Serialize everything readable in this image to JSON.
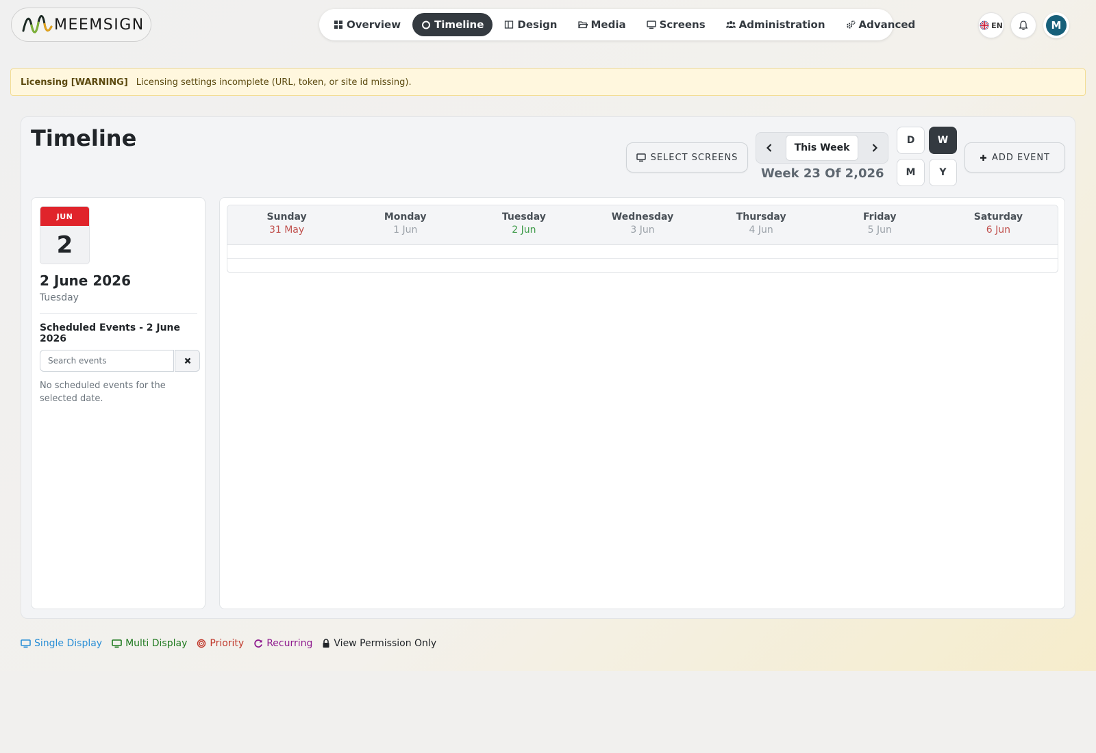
{
  "brand": {
    "name": "MEEMSIGN"
  },
  "nav": {
    "items": [
      {
        "label": "Overview",
        "icon": "grid-icon"
      },
      {
        "label": "Timeline",
        "icon": "circle-icon",
        "active": true
      },
      {
        "label": "Design",
        "icon": "columns-icon"
      },
      {
        "label": "Media",
        "icon": "folder-icon"
      },
      {
        "label": "Screens",
        "icon": "monitor-icon"
      },
      {
        "label": "Administration",
        "icon": "users-icon"
      },
      {
        "label": "Advanced",
        "icon": "gears-icon"
      }
    ]
  },
  "topbar": {
    "language": "EN",
    "avatar_initial": "M"
  },
  "warning": {
    "title": "Licensing [WARNING]",
    "message": "Licensing settings incomplete (URL, token, or site id missing)."
  },
  "page": {
    "title": "Timeline",
    "select_screens_label": "SELECT SCREENS",
    "this_week_label": "This Week",
    "week_label": "Week 23 Of 2,026",
    "add_event_label": "ADD EVENT",
    "views": {
      "day": "D",
      "week": "W",
      "month": "M",
      "year": "Y",
      "active": "W"
    }
  },
  "sidebar": {
    "cal_month": "JUN",
    "cal_day": "2",
    "selected_date": "2 June 2026",
    "selected_weekday": "Tuesday",
    "scheduled_title": "Scheduled Events - 2 June 2026",
    "search_placeholder": "Search events",
    "search_value": "",
    "empty_message": "No scheduled events for the selected date."
  },
  "week": {
    "days": [
      {
        "name": "Sunday",
        "date": "31 May",
        "color": "#c0504d"
      },
      {
        "name": "Monday",
        "date": "1 Jun",
        "color": "#9aa1a8"
      },
      {
        "name": "Tuesday",
        "date": "2 Jun",
        "color": "#3f9b4a"
      },
      {
        "name": "Wednesday",
        "date": "3 Jun",
        "color": "#9aa1a8"
      },
      {
        "name": "Thursday",
        "date": "4 Jun",
        "color": "#9aa1a8"
      },
      {
        "name": "Friday",
        "date": "5 Jun",
        "color": "#9aa1a8"
      },
      {
        "name": "Saturday",
        "date": "6 Jun",
        "color": "#c0504d"
      }
    ]
  },
  "legend": [
    {
      "label": "Single Display",
      "color": "#2b8fd6",
      "icon": "monitor-icon"
    },
    {
      "label": "Multi Display",
      "color": "#1f7a1f",
      "icon": "monitor-icon"
    },
    {
      "label": "Priority",
      "color": "#c0392b",
      "icon": "target-icon"
    },
    {
      "label": "Recurring",
      "color": "#8e1a8e",
      "icon": "refresh-icon"
    },
    {
      "label": "View Permission Only",
      "color": "#212529",
      "icon": "lock-icon"
    }
  ]
}
